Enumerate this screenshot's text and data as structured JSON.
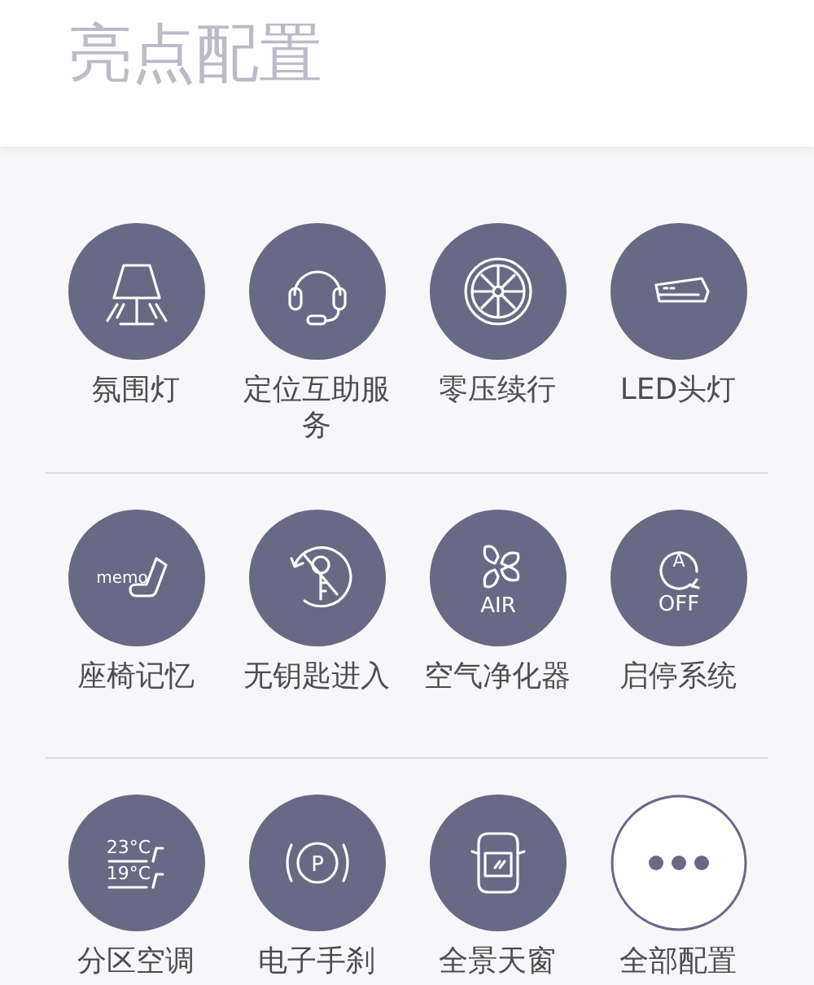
{
  "title": "亮点配置",
  "sections": [
    {
      "items": [
        {
          "kind": "lamp",
          "label": "氛围灯"
        },
        {
          "kind": "headset",
          "label": "定位互助服务"
        },
        {
          "kind": "tire",
          "label": "零压续行"
        },
        {
          "kind": "headlight",
          "label": "LED头灯"
        }
      ]
    },
    {
      "items": [
        {
          "kind": "seat",
          "label": "座椅记忆",
          "icon_texts": [
            "memo"
          ]
        },
        {
          "kind": "key",
          "label": "无钥匙进入"
        },
        {
          "kind": "fan",
          "label": "空气净化器",
          "icon_texts": [
            "AIR"
          ]
        },
        {
          "kind": "autostop",
          "label": "启停系统",
          "icon_texts": [
            "A",
            "OFF"
          ]
        }
      ]
    },
    {
      "items": [
        {
          "kind": "climate",
          "label": "分区空调",
          "icon_texts": [
            "23°C",
            "19°C"
          ]
        },
        {
          "kind": "parking",
          "label": "电子手刹",
          "icon_texts": [
            "P"
          ]
        },
        {
          "kind": "car",
          "label": "全景天窗"
        },
        {
          "kind": "more",
          "label": "全部配置"
        }
      ]
    }
  ]
}
